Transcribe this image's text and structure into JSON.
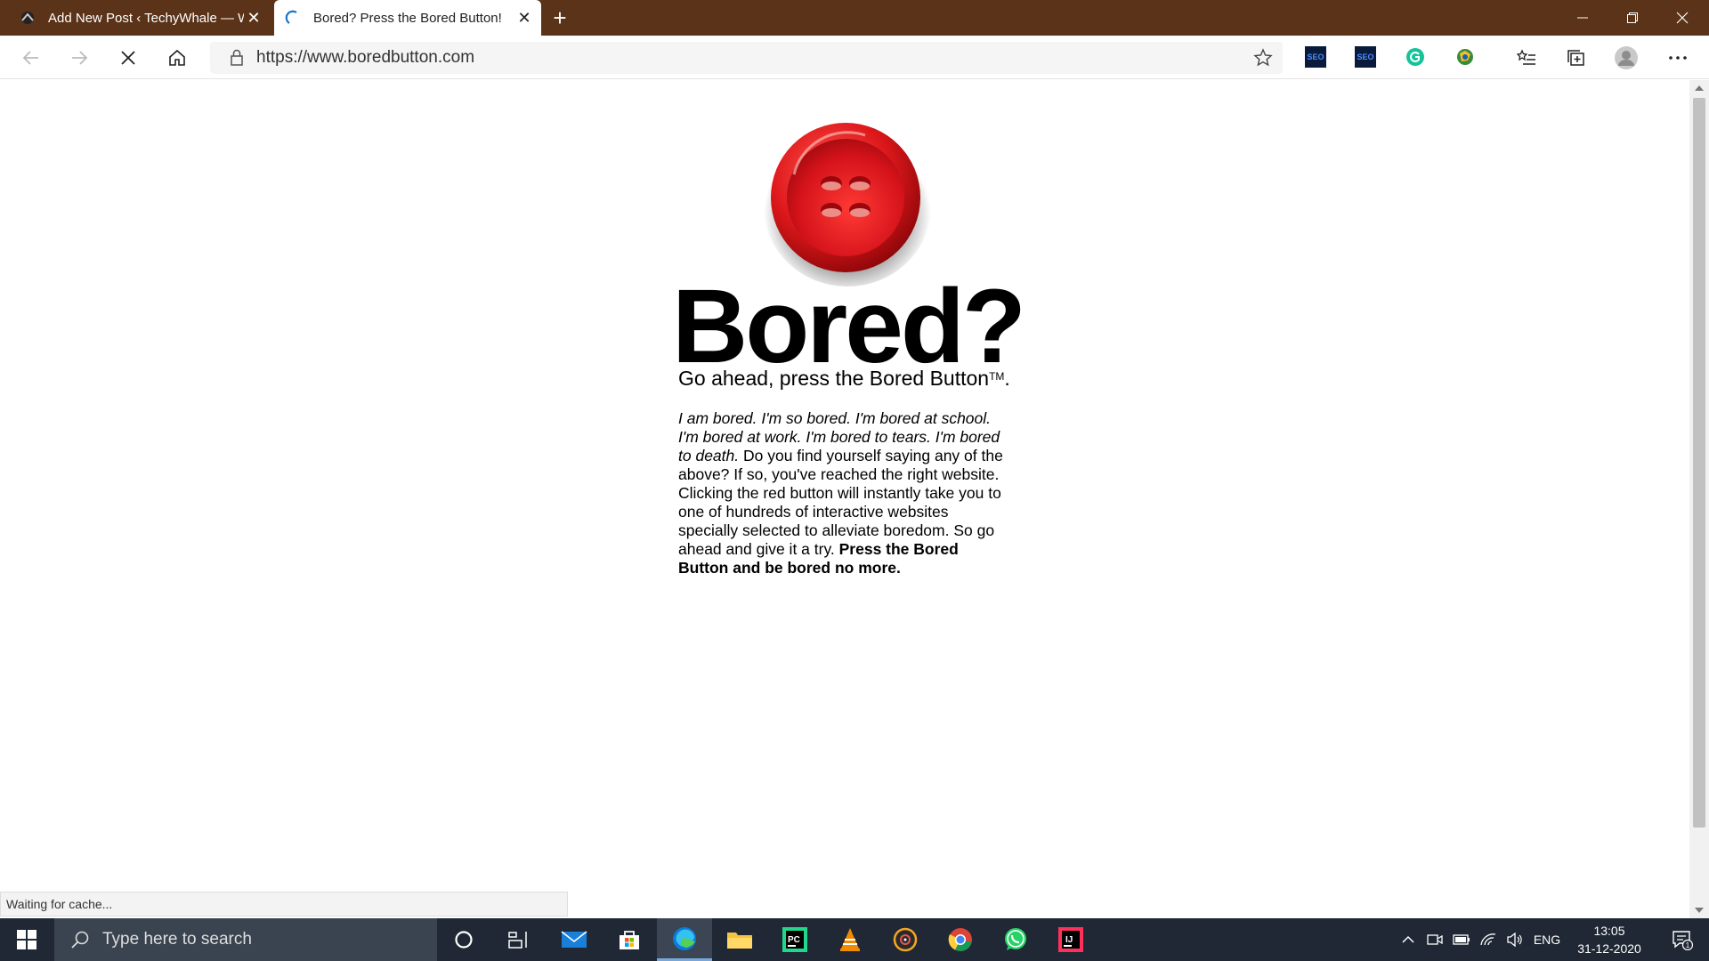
{
  "browser": {
    "tabs": [
      {
        "title": "Add New Post ‹ TechyWhale — W",
        "active": false
      },
      {
        "title": "Bored? Press the Bored Button!",
        "active": true
      }
    ],
    "url": "https://www.boredbutton.com",
    "status_text": "Waiting for cache..."
  },
  "page": {
    "headline": "Bored?",
    "tagline": "Go ahead, press the Bored Button",
    "trademark": "TM",
    "tagline_end": ".",
    "paragraph": {
      "italic": "I am bored. I'm so bored. I'm bored at school. I'm bored at work. I'm bored to tears. I'm bored to death.",
      "regular": " Do you find yourself saying any of the above? If so, you've reached the right website. Clicking the red button will instantly take you to one of hundreds of interactive websites specially selected to alleviate boredom. So go ahead and give it a try. ",
      "bold": "Press the Bored Button and be bored no more."
    }
  },
  "taskbar": {
    "search_placeholder": "Type here to search",
    "language": "ENG",
    "time": "13:05",
    "date": "31-12-2020",
    "notification_count": "1"
  },
  "colors": {
    "titlebar": "#5a3318",
    "taskbar": "#1f2834",
    "button_red": "#e0191c"
  }
}
